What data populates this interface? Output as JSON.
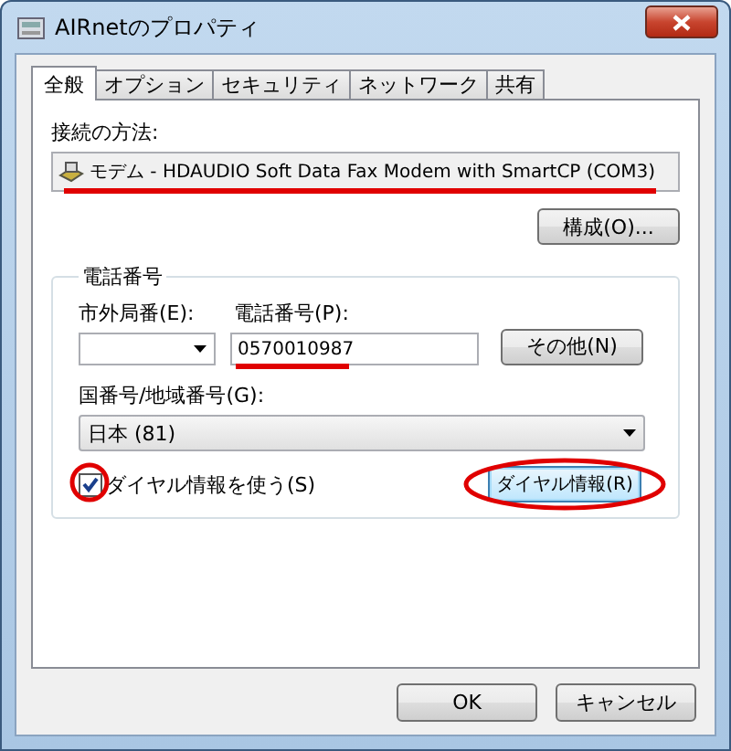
{
  "window": {
    "title": "AIRnetのプロパティ"
  },
  "tabs": [
    {
      "label": "全般",
      "selected": true
    },
    {
      "label": "オプション",
      "selected": false
    },
    {
      "label": "セキュリティ",
      "selected": false
    },
    {
      "label": "ネットワーク",
      "selected": false
    },
    {
      "label": "共有",
      "selected": false
    }
  ],
  "connection": {
    "label": "接続の方法:",
    "device": "モデム - HDAUDIO Soft Data Fax Modem with SmartCP (COM3)",
    "configure_button": "構成(O)..."
  },
  "phone_group": {
    "title": "電話番号",
    "area_code": {
      "label": "市外局番(E):"
    },
    "phone_number": {
      "label": "電話番号(P):",
      "value": "0570010987"
    },
    "other_button": "その他(N)",
    "country": {
      "label": "国番号/地域番号(G):",
      "value": "日本 (81)"
    },
    "use_dialing_rules": {
      "label": "ダイヤル情報を使う(S)",
      "checked": true
    },
    "dialing_rules_button": {
      "label": "ダイヤル情報(R)",
      "focused": true
    }
  },
  "buttons": [
    "OK",
    "キャンセル"
  ]
}
